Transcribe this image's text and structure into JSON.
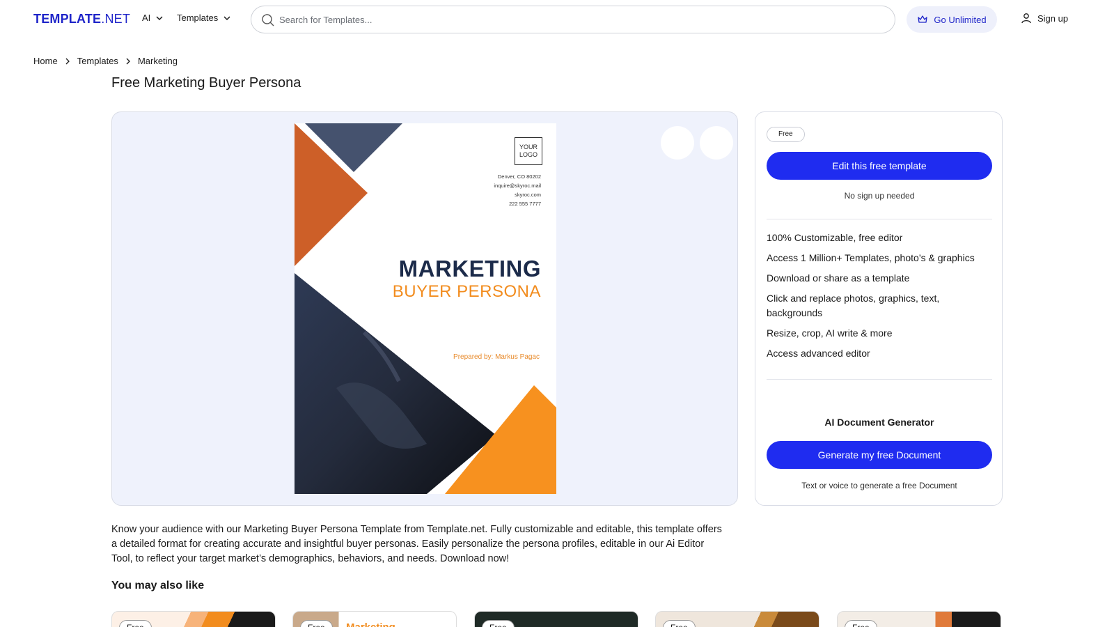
{
  "header": {
    "logo_main": "TEMPLATE",
    "logo_suffix": ".NET",
    "nav": [
      {
        "label": "AI"
      },
      {
        "label": "Templates"
      }
    ],
    "search": {
      "placeholder": "Search for Templates..."
    },
    "go_unlimited": "Go Unlimited",
    "sign_up": "Sign up"
  },
  "breadcrumb": [
    "Home",
    "Templates",
    "Marketing"
  ],
  "page": {
    "title": "Free Marketing Buyer Persona"
  },
  "preview": {
    "doc": {
      "logo_text": "YOUR LOGO",
      "contact": [
        "Denver, CO 80202",
        "inquire@skyroc.mail",
        "skyroc.com",
        "222 555 7777"
      ],
      "title_main": "MARKETING",
      "title_sub": "BUYER PERSONA",
      "prepared_by": "Prepared by: Markus Pagac"
    }
  },
  "sidebar": {
    "badge": "Free",
    "edit_button": "Edit this free template",
    "no_signup": "No sign up needed",
    "features": [
      "100% Customizable, free editor",
      "Access 1 Million+ Templates, photo’s & graphics",
      "Download or share as a template",
      "Click and replace photos, graphics, text, backgrounds",
      "Resize, crop, AI write & more",
      "Access advanced editor"
    ],
    "ai_heading": "AI Document Generator",
    "generate_button": "Generate my free Document",
    "generate_note": "Text or voice to generate a free Document"
  },
  "description": "Know your audience with our Marketing Buyer Persona Template from Template.net. Fully customizable and editable, this template offers a detailed format for creating accurate and insightful buyer personas. Easily personalize the persona profiles, editable in our Ai Editor Tool, to reflect your target market’s demographics, behaviors, and needs. Download now!",
  "also_like": {
    "heading": "You may also like",
    "items": [
      {
        "badge": "Free"
      },
      {
        "badge": "Free",
        "text": "Marketing"
      },
      {
        "badge": "Free"
      },
      {
        "badge": "Free"
      },
      {
        "badge": "Free"
      }
    ]
  },
  "colors": {
    "brand_blue": "#1f2cf0",
    "orange": "#f28c1e",
    "navy": "#1c2b4a",
    "preview_bg": "#eff2fc"
  }
}
